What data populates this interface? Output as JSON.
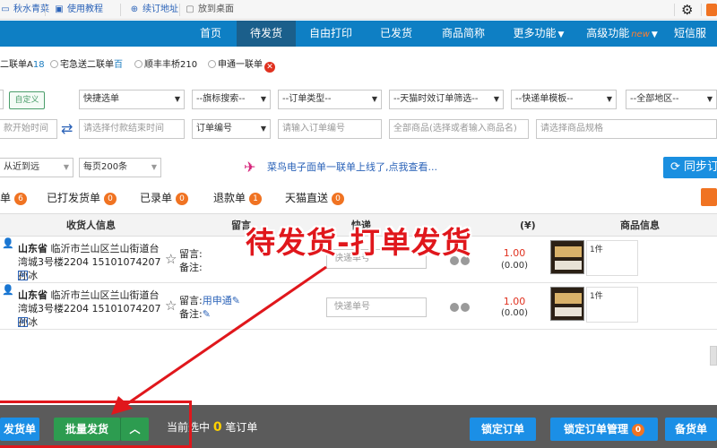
{
  "topbar": {
    "links": [
      {
        "icon": "screen-icon",
        "label": "秋水青菜"
      },
      {
        "icon": "book-icon",
        "label": "使用教程"
      },
      {
        "icon": "cart-icon",
        "label": "续订地址"
      },
      {
        "icon": "desktop-icon",
        "label": "放到桌面"
      }
    ]
  },
  "nav": {
    "items": [
      {
        "label": "首页"
      },
      {
        "label": "待发货"
      },
      {
        "label": "自由打印"
      },
      {
        "label": "已发货"
      },
      {
        "label": "商品简称"
      },
      {
        "label": "更多功能"
      },
      {
        "label": "高级功能",
        "badge": "new"
      },
      {
        "label": "短信服"
      }
    ],
    "active_index": 1
  },
  "templates": {
    "items": [
      {
        "label": "二联单A",
        "suffix": "18"
      },
      {
        "label": "宅急送二联单",
        "suffix": "百"
      },
      {
        "label": "顺丰丰桥210"
      },
      {
        "label": "申通一联单"
      }
    ]
  },
  "filters": {
    "customize_label": "自定义",
    "quick_select": "快捷选单",
    "flag_search": "--旗标搜索--",
    "order_type": "--订单类型--",
    "tmall_filter": "--天猫时效订单筛选--",
    "express_template": "--快递单模板--",
    "region": "--全部地区--",
    "start_time_placeholder": "款开始时间",
    "end_time_placeholder": "请选择付款结束时间",
    "order_no_select": "订单编号",
    "order_no_placeholder": "请输入订单编号",
    "goods_placeholder": "全部商品(选择或者输入商品名)",
    "spec_placeholder": "请选择商品规格",
    "sort": "从近到远",
    "page_size": "每页200条",
    "promo_text": "菜鸟电子面单一联单上线了,点我查看...",
    "sync_label": "同步订"
  },
  "tabs": [
    {
      "label": "单",
      "count": "6"
    },
    {
      "label": "已打发货单",
      "count": "0"
    },
    {
      "label": "已录单",
      "count": "0"
    },
    {
      "label": "退款单",
      "count": "1"
    },
    {
      "label": "天猫直送",
      "count": "0"
    }
  ],
  "table": {
    "headers": {
      "receiver": "收货人信息",
      "message": "留言",
      "express": "快递",
      "amount": "(¥)",
      "goods": "商品信息"
    },
    "rows": [
      {
        "province": "山东省",
        "address": "临沂市兰山区兰山街道台湾城3号楼2204 15101074207 孙冰",
        "message_label": "留言:",
        "note_label": "备注:",
        "message_value": "",
        "tracking_placeholder": "快递单号",
        "price": "1.00",
        "discount": "(0.00)",
        "qty": "1件"
      },
      {
        "province": "山东省",
        "address": "临沂市兰山区兰山街道台湾城3号楼2204 15101074207 孙冰",
        "message_label": "留言:",
        "note_label": "备注:",
        "message_value": "用申通",
        "tracking_placeholder": "快递单号",
        "price": "1.00",
        "discount": "(0.00)",
        "qty": "1件"
      }
    ]
  },
  "bottom": {
    "ship_label": "发货单",
    "batch_ship_label": "批量发货",
    "selected_prefix": "当前选中",
    "selected_count": "0",
    "selected_suffix": "笔订单",
    "lock_label": "锁定订单",
    "lock_manage_label": "锁定订单管理",
    "lock_manage_count": "0",
    "backup_label": "备货单"
  },
  "annotation": {
    "callout": "待发货-打单发货"
  },
  "colors": {
    "nav_bg": "#0e7fc4",
    "nav_active": "#1b5f8b",
    "annotation_red": "#e0171c",
    "count_badge": "#f07322",
    "green_button": "#2d9c50",
    "blue_button": "#1b8fe6"
  }
}
